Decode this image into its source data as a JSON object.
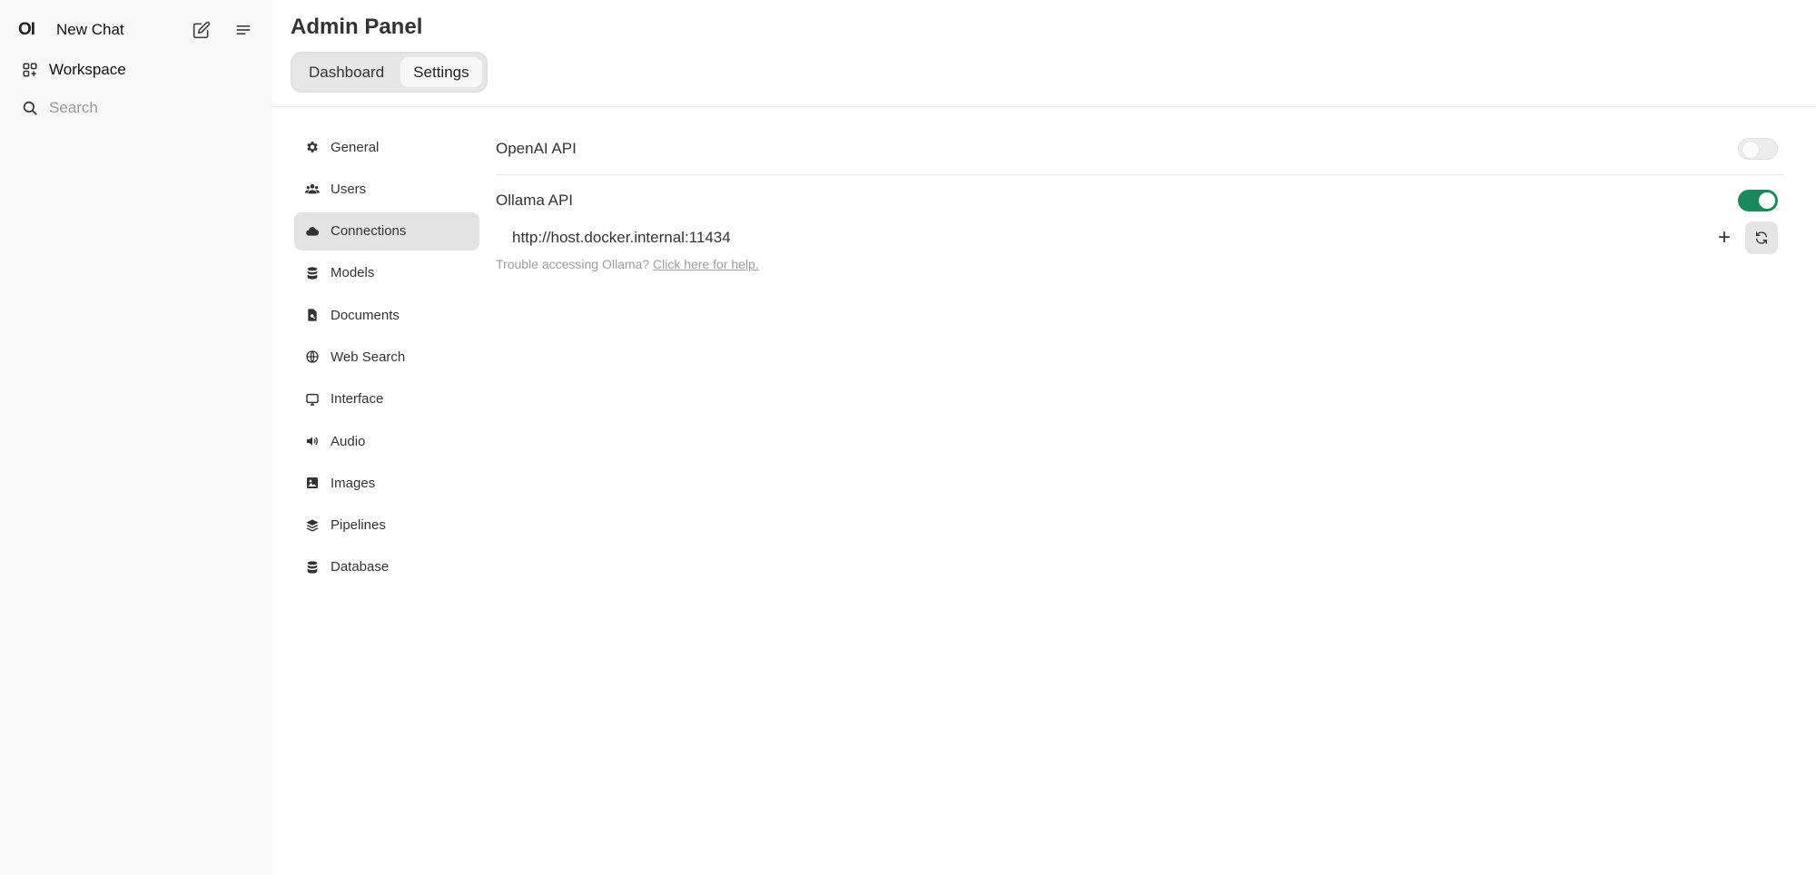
{
  "sidebar": {
    "logo": "OI",
    "new_chat": "New Chat",
    "workspace": "Workspace",
    "search_placeholder": "Search"
  },
  "header": {
    "title": "Admin Panel",
    "tabs": [
      {
        "label": "Dashboard",
        "active": false
      },
      {
        "label": "Settings",
        "active": true
      }
    ]
  },
  "settings_nav": [
    {
      "label": "General",
      "icon": "gear-icon"
    },
    {
      "label": "Users",
      "icon": "users-icon"
    },
    {
      "label": "Connections",
      "icon": "cloud-icon",
      "active": true
    },
    {
      "label": "Models",
      "icon": "database-icon"
    },
    {
      "label": "Documents",
      "icon": "document-search-icon"
    },
    {
      "label": "Web Search",
      "icon": "globe-icon"
    },
    {
      "label": "Interface",
      "icon": "monitor-icon"
    },
    {
      "label": "Audio",
      "icon": "speaker-icon"
    },
    {
      "label": "Images",
      "icon": "image-icon"
    },
    {
      "label": "Pipelines",
      "icon": "layers-icon"
    },
    {
      "label": "Database",
      "icon": "database-icon"
    }
  ],
  "connections": {
    "openai": {
      "label": "OpenAI API",
      "enabled": false
    },
    "ollama": {
      "label": "Ollama API",
      "enabled": true,
      "url": "http://host.docker.internal:11434",
      "add_label": "+"
    },
    "help_prefix": "Trouble accessing Ollama?",
    "help_link": "Click here for help."
  },
  "colors": {
    "accent_green": "#1a8a5c",
    "sidebar_bg": "#f8f8f8",
    "active_nav_bg": "#e3e3e3"
  }
}
